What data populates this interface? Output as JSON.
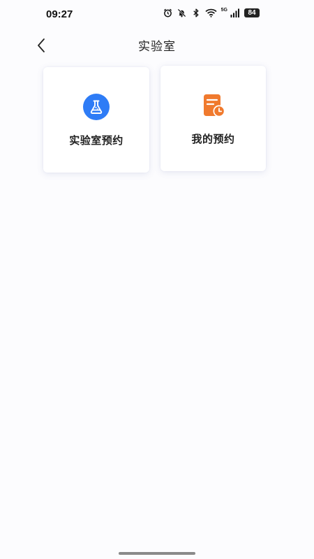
{
  "status_bar": {
    "time": "09:27",
    "network_label": "5G",
    "battery_level": "84",
    "icons": [
      "alarm-icon",
      "bell-off-icon",
      "bluetooth-icon",
      "wifi-icon",
      "signal-icon",
      "battery-icon"
    ]
  },
  "nav": {
    "back_icon": "chevron-left-icon",
    "title": "实验室"
  },
  "cards": [
    {
      "label": "实验室预约",
      "icon": "flask-icon",
      "icon_color": "#2e7cf6"
    },
    {
      "label": "我的预约",
      "icon": "document-clock-icon",
      "icon_color": "#f07a2e"
    }
  ],
  "colors": {
    "background": "#fcfcfe",
    "card_background": "#ffffff",
    "flask_blue": "#2e7cf6",
    "doc_orange": "#f07a2e"
  }
}
